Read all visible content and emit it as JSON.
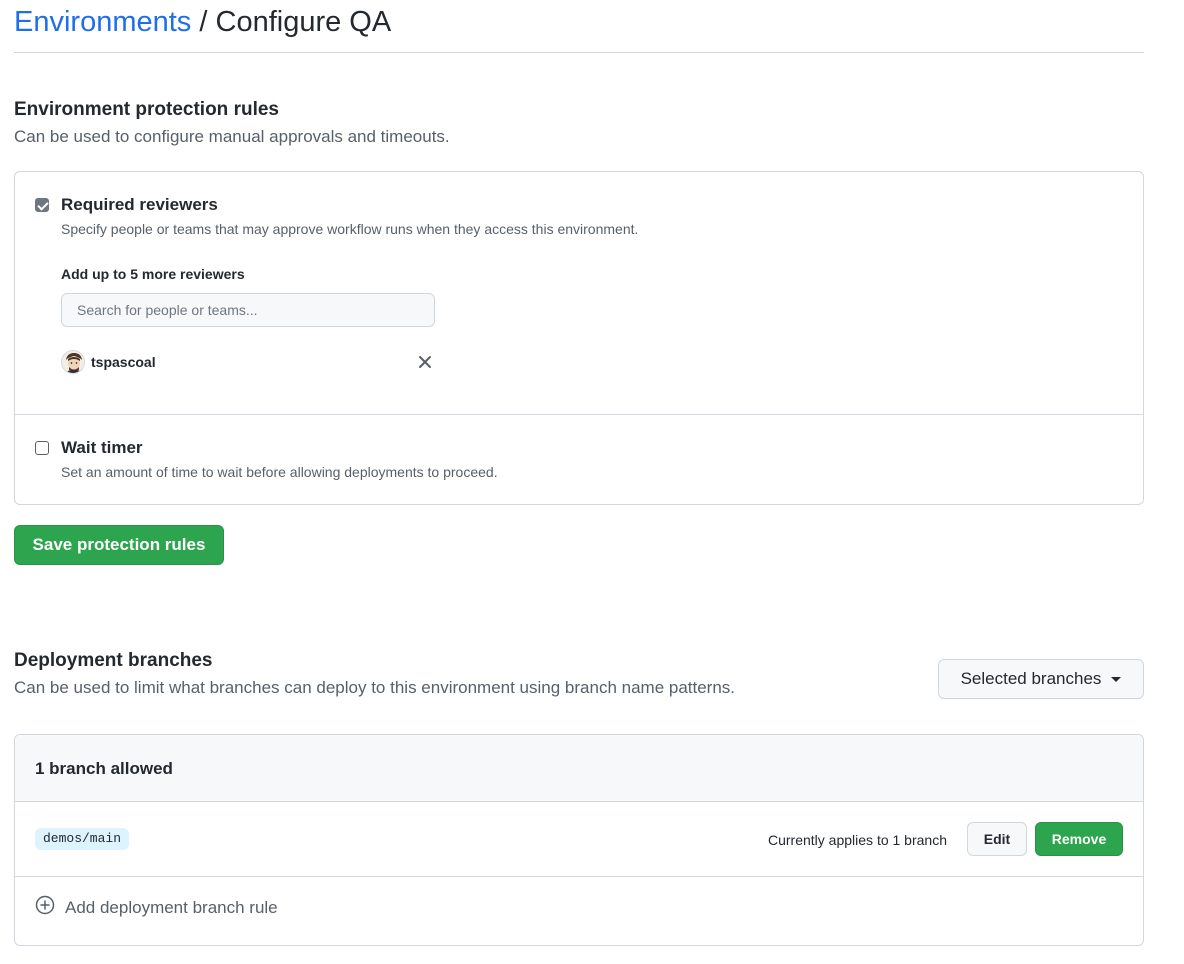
{
  "header": {
    "breadcrumb_link": "Environments",
    "breadcrumb_separator": "/",
    "breadcrumb_current": "Configure QA"
  },
  "protection": {
    "title": "Environment protection rules",
    "description": "Can be used to configure manual approvals and timeouts.",
    "required_reviewers": {
      "checked": true,
      "label": "Required reviewers",
      "hint": "Specify people or teams that may approve workflow runs when they access this environment.",
      "add_label": "Add up to 5 more reviewers",
      "search_placeholder": "Search for people or teams...",
      "reviewers": [
        {
          "name": "tspascoal"
        }
      ]
    },
    "wait_timer": {
      "checked": false,
      "label": "Wait timer",
      "hint": "Set an amount of time to wait before allowing deployments to proceed."
    },
    "save_label": "Save protection rules"
  },
  "deployment": {
    "title": "Deployment branches",
    "description": "Can be used to limit what branches can deploy to this environment using branch name patterns.",
    "selector_label": "Selected branches",
    "count_label": "1 branch allowed",
    "rules": [
      {
        "pattern": "demos/main",
        "applies_text": "Currently applies to 1 branch",
        "edit_label": "Edit",
        "remove_label": "Remove"
      }
    ],
    "add_rule_label": "Add deployment branch rule"
  },
  "colors": {
    "link": "#1f6feb",
    "primary_button": "#2da44e",
    "border": "#d0d7de",
    "muted_text": "#57606a",
    "branch_pill": "#ddf4ff"
  },
  "icons": [
    "checkbox-checked-icon",
    "checkbox-unchecked-icon",
    "avatar",
    "close-icon",
    "caret-down-icon",
    "plus-circle-icon"
  ]
}
